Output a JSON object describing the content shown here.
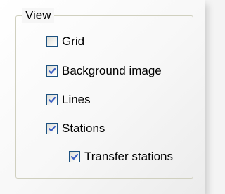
{
  "group": {
    "title": "View",
    "options": [
      {
        "label": "Grid",
        "checked": false
      },
      {
        "label": "Background image",
        "checked": true
      },
      {
        "label": "Lines",
        "checked": true
      },
      {
        "label": "Stations",
        "checked": true
      },
      {
        "label": "Transfer stations",
        "checked": true
      }
    ]
  },
  "colors": {
    "check_mark": "#3a5fc4",
    "checkbox_border": "#1c5180",
    "group_border": "#d0d0bf"
  },
  "icons": {
    "check": "check-icon"
  }
}
